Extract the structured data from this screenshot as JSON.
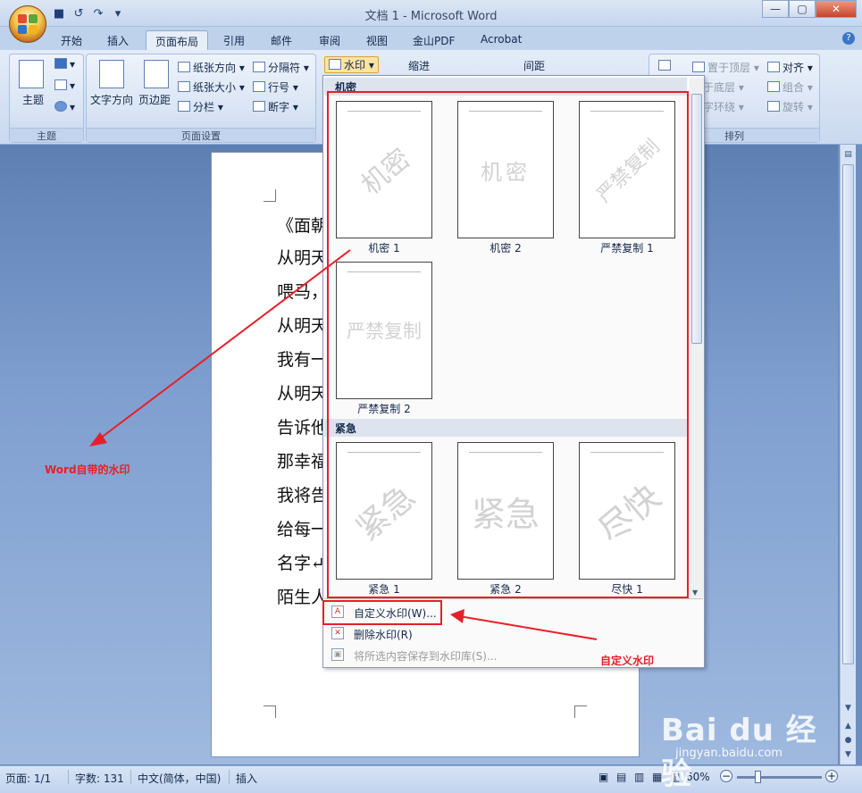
{
  "window": {
    "title": "文档 1 - Microsoft Word"
  },
  "tabs": [
    "开始",
    "插入",
    "页面布局",
    "引用",
    "邮件",
    "审阅",
    "视图",
    "金山PDF",
    "Acrobat"
  ],
  "ribbon": {
    "theme": {
      "label": "主题",
      "button": "主题"
    },
    "page_setup": {
      "label": "页面设置",
      "text_direction": "文字方向",
      "margins": "页边距",
      "orientation": "纸张方向",
      "size": "纸张大小",
      "columns": "分栏",
      "breaks": "分隔符",
      "line_numbers": "行号",
      "hyphenation": "断字"
    },
    "watermark_button": "水印",
    "indent": "缩进",
    "spacing": "间距",
    "arrange": {
      "label": "排列",
      "bring_front": "置于顶层",
      "send_back": "置于底层",
      "text_wrap": "文字环绕",
      "align": "对齐",
      "group": "组合",
      "rotate": "旋转"
    }
  },
  "document": {
    "lines": [
      "《面朝",
      "从明天",
      "喂马，",
      "从明天",
      "我有一",
      "从明天",
      "告诉他",
      "那幸福",
      "我将告",
      "给每一",
      "名字↵",
      "陌生人"
    ]
  },
  "gallery": {
    "categories": [
      {
        "name": "机密",
        "items": [
          {
            "label": "机密 1",
            "watermark": "机密"
          },
          {
            "label": "机密 2",
            "watermark": "机密"
          },
          {
            "label": "严禁复制 1",
            "watermark": "严禁复制"
          },
          {
            "label": "严禁复制 2",
            "watermark": "严禁复制"
          }
        ]
      },
      {
        "name": "紧急",
        "items": [
          {
            "label": "紧急 1",
            "watermark": "紧急"
          },
          {
            "label": "紧急 2",
            "watermark": "紧急"
          },
          {
            "label": "尽快 1",
            "watermark": "尽快"
          }
        ]
      }
    ],
    "menu": {
      "custom": "自定义水印(W)...",
      "remove": "删除水印(R)",
      "save": "将所选内容保存到水印库(S)..."
    }
  },
  "annotations": {
    "builtin": "Word自带的水印",
    "custom": "自定义水印"
  },
  "statusbar": {
    "page": "页面: 1/1",
    "words": "字数: 131",
    "language": "中文(简体，中国)",
    "mode": "插入",
    "zoom": "60%"
  },
  "watermark_site": {
    "logo": "Bai du 经验",
    "url": "jingyan.baidu.com"
  },
  "colors": {
    "annotation": "#e6202a",
    "ribbon": "#dbe6f5"
  }
}
